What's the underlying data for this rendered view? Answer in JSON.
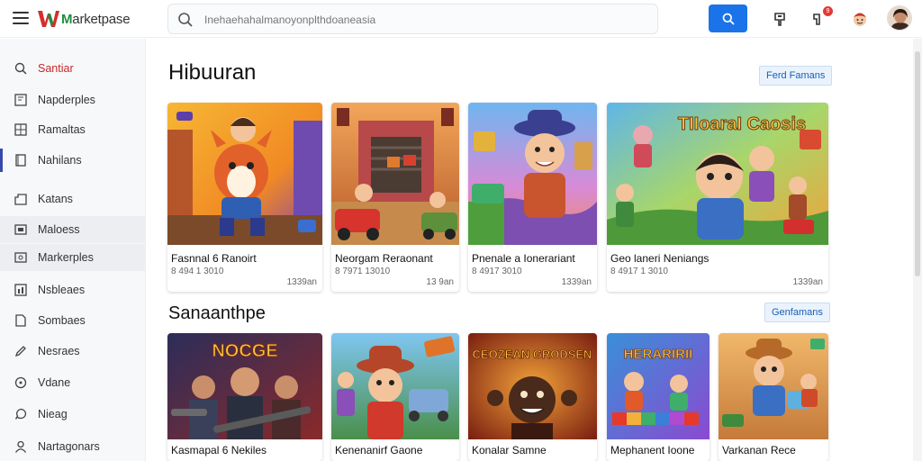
{
  "brand": {
    "name_prefix": "M",
    "name_rest": "arketpase"
  },
  "search": {
    "placeholder": "Inehaehahalmanoyonplthdoaneasia"
  },
  "header_icons": [
    "chat-icon",
    "notification-icon",
    "character-icon",
    "avatar"
  ],
  "notification_badge": "9",
  "sidebar": {
    "items": [
      {
        "label": "Santiar",
        "icon": "search-icon"
      },
      {
        "label": "Napderples",
        "icon": "monitor-icon"
      },
      {
        "label": "Ramaltas",
        "icon": "grid-icon"
      },
      {
        "label": "Nahilans",
        "icon": "book-icon"
      },
      {
        "label": "Katans",
        "icon": "tag-icon"
      },
      {
        "label": "Maloess",
        "icon": "window-icon"
      },
      {
        "label": "Markerples",
        "icon": "image-icon"
      },
      {
        "label": "Nsbleaes",
        "icon": "chart-icon"
      },
      {
        "label": "Sombaes",
        "icon": "box-icon"
      },
      {
        "label": "Nesraes",
        "icon": "pencil-icon"
      },
      {
        "label": "Vdane",
        "icon": "disc-icon"
      },
      {
        "label": "Nieag",
        "icon": "chat-bubble-icon"
      },
      {
        "label": "Nartagonars",
        "icon": "user-icon"
      }
    ]
  },
  "sections": [
    {
      "title": "Hibuuran",
      "see_all": "Ferd Famans",
      "cards": [
        {
          "title": "Fasnnal 6 Ranoirt",
          "meta": "8 494 1 3010",
          "price": "1339an",
          "scene": "fox-hero"
        },
        {
          "title": "Neorgam Reraonant",
          "meta": "8 7971 13010",
          "price": "13 9an",
          "scene": "garage-cars"
        },
        {
          "title": "Pnenale a Ionerariant",
          "meta": "8 4917 3010",
          "price": "1339an",
          "scene": "cowboy-boy"
        },
        {
          "title": "Geo laneri Neniangs",
          "meta": "8 4917 1 3010",
          "price": "1339an",
          "scene": "team-adventure"
        }
      ]
    },
    {
      "title": "Sanaanthpe",
      "see_all": "Genfamans",
      "cards": [
        {
          "title": "Kasmapal 6 Nekiles",
          "title_art": "NOCGE",
          "scene": "shooters"
        },
        {
          "title": "Kenenanirf Gaone",
          "title_art": "",
          "scene": "cowboy-truck"
        },
        {
          "title": "Konalar Samne",
          "title_art": "CEOZEAN GRODSEN",
          "scene": "monster-fire"
        },
        {
          "title": "Mephanent Ioone",
          "title_art": "HERARIRII",
          "scene": "puzzle-blocks"
        },
        {
          "title": "Varkanan Rece",
          "title_art": "",
          "scene": "desert-runner"
        }
      ]
    }
  ],
  "card_title_art": "TIIoaraI Caosis",
  "card_badge": "",
  "colors": {
    "accent": "#1a73e8",
    "brand_green": "#1e8e3e",
    "brand_red": "#d32f2f"
  }
}
